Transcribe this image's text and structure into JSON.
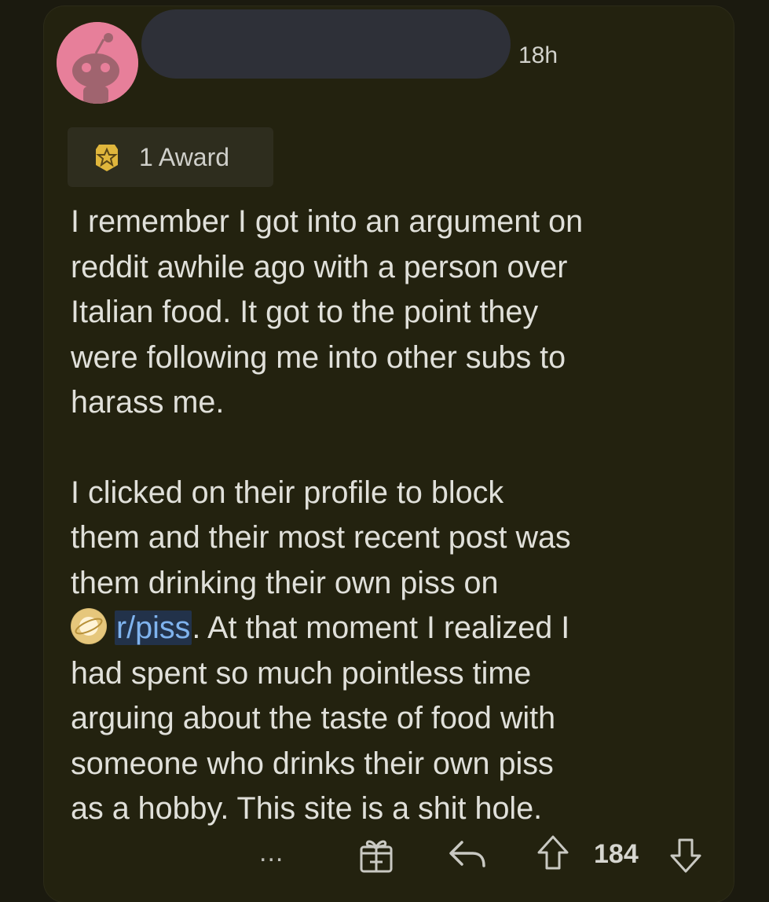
{
  "post": {
    "timestamp": "18h",
    "award_label": "1 Award",
    "paragraphs": [
      {
        "lines": [
          "I remember I got into an argument on",
          "reddit awhile ago with a person over",
          "Italian food. It got to the point they",
          "were following me into other subs to",
          "harass me."
        ]
      },
      {
        "lines": [
          "I clicked on their profile to block",
          "them and their most recent post was",
          "them drinking their own piss on"
        ],
        "link_line": {
          "link": "r/piss",
          "after": ". At that moment I realized I"
        },
        "lines_after": [
          "had spent so much pointless time",
          "arguing about the taste of food with",
          "someone who drinks their own piss",
          "as a hobby. This site is a shit hole."
        ]
      }
    ]
  },
  "actions": {
    "more_label": "...",
    "score": "184"
  },
  "icons": {
    "avatar": "snoo-avatar",
    "award": "award-icon",
    "subreddit": "subreddit-icon",
    "gift": "gift-icon",
    "reply": "reply-icon",
    "upvote": "upvote-icon",
    "downvote": "downvote-icon"
  },
  "colors": {
    "background": "#1b1a0f",
    "card": "#23220f",
    "avatar_bg": "#e77f9a",
    "link": "#7fb3ee",
    "award_gold": "#e0b63c"
  }
}
